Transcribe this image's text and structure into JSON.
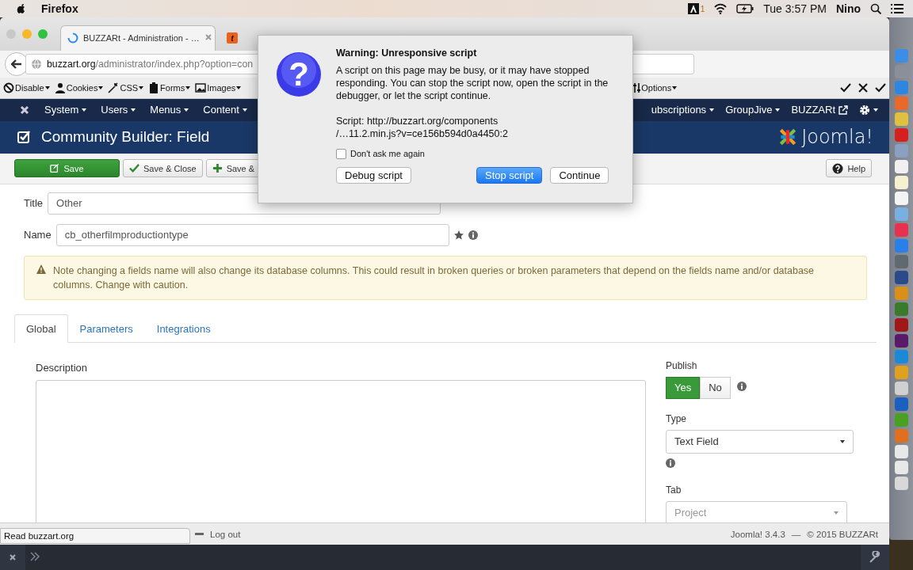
{
  "menubar": {
    "app": "Firefox",
    "adobe_badge": "1",
    "clock": "Tue 3:57 PM",
    "user": "Nino"
  },
  "browser": {
    "tabs": [
      {
        "kind": "page",
        "title": "BUZZARt - Administration - …",
        "selected": true
      },
      {
        "kind": "favicon",
        "favicon_letter": "t",
        "selected": false
      }
    ],
    "url": {
      "host": "buzzart.org",
      "path": "/administrator/index.php?option=con"
    },
    "webdev_left": [
      "Disable",
      "Cookies",
      "CSS",
      "Forms",
      "Images"
    ],
    "webdev_right": "Options"
  },
  "joomla": {
    "nav_left": [
      "System",
      "Users",
      "Menus",
      "Content"
    ],
    "nav_right": [
      {
        "label": "ubscriptions",
        "external": false
      },
      {
        "label": "GroupJive",
        "external": false
      },
      {
        "label": "BUZZARt",
        "external": true
      }
    ],
    "header_title": "Community Builder: Field",
    "logo_text": "Joomla!",
    "toolbar": [
      {
        "kind": "primary",
        "label": "Save"
      },
      {
        "kind": "close",
        "label": "Save & Close"
      },
      {
        "kind": "new",
        "label": "Save &"
      }
    ],
    "help": "Help",
    "fields": [
      {
        "label": "Title",
        "value": "Other"
      },
      {
        "label": "Name",
        "value": "cb_otherfilmproductiontype"
      }
    ],
    "alert": "Note changing a fields name will also change its database columns. This could result in broken queries or broken parameters that depend on the fields name and/or database columns. Change with caution.",
    "tabs": [
      {
        "label": "Global",
        "selected": true
      },
      {
        "label": "Parameters",
        "selected": false
      },
      {
        "label": "Integrations",
        "selected": false
      }
    ],
    "description_label": "Description",
    "publish": {
      "label": "Publish",
      "options": [
        {
          "label": "Yes",
          "selected": true
        },
        {
          "label": "No",
          "selected": false
        }
      ]
    },
    "type": {
      "label": "Type",
      "value": "Text Field"
    },
    "tab": {
      "label": "Tab",
      "value": "Project",
      "disabled": true
    },
    "footer": {
      "logout": "Log out",
      "version": "Joomla! 3.4.3",
      "separator": "—",
      "copyright": "© 2015 BUZZARt"
    }
  },
  "status_popup": "Read buzzart.org",
  "dialog": {
    "icon_glyph": "?",
    "title": "Warning: Unresponsive script",
    "message": "A script on this page may be busy, or it may have stopped responding. You can stop the script now, open the script in the debugger, or let the script continue.",
    "script_lines": [
      "Script: http://buzzart.org/components",
      "/…11.2.min.js?v=ce156b594d0a4450:2"
    ],
    "checkbox": {
      "label": "Don't ask me again",
      "checked": false
    },
    "buttons": [
      {
        "label": "Debug script",
        "default": false
      },
      {
        "label": "Stop script",
        "default": true
      },
      {
        "label": "Continue",
        "default": false
      }
    ]
  }
}
